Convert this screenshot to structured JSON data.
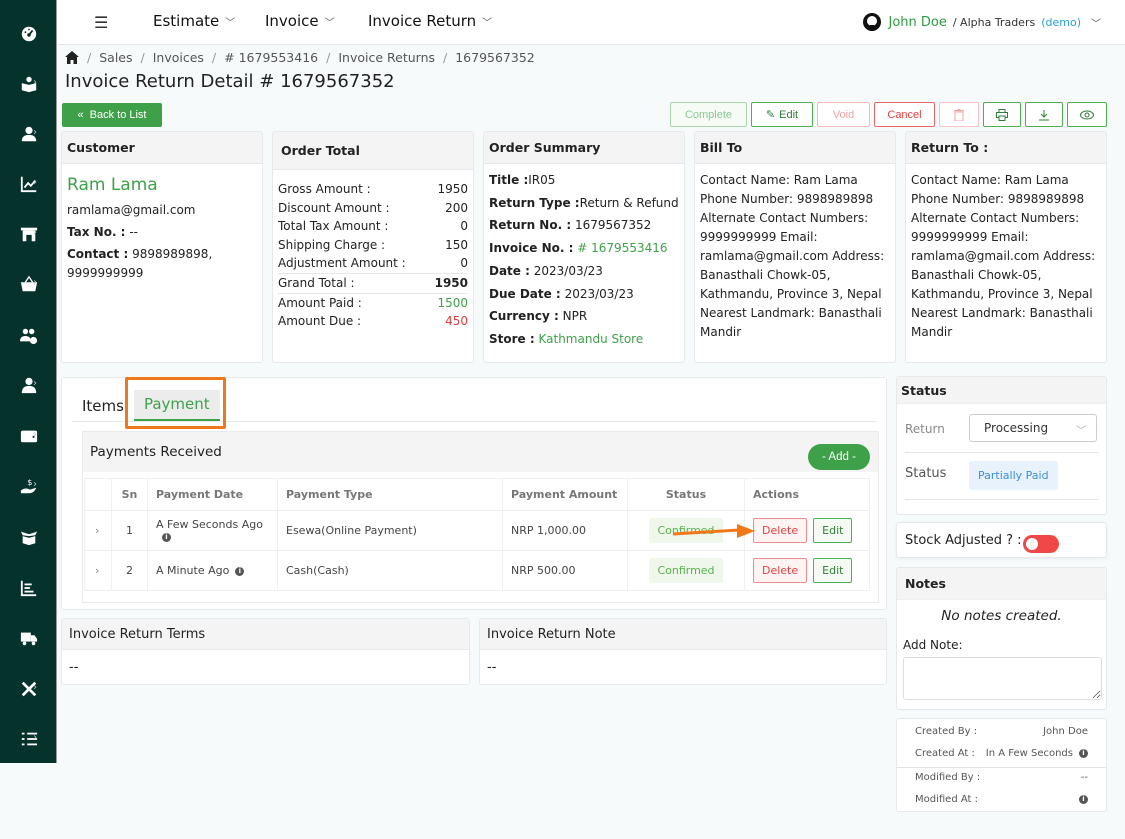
{
  "sidebar": {
    "items": [
      {
        "icon": "dashboard-icon",
        "has_sub": false
      },
      {
        "icon": "reader-icon",
        "has_sub": true
      },
      {
        "icon": "user-icon",
        "has_sub": true
      },
      {
        "icon": "chart-line-icon",
        "has_sub": true
      },
      {
        "icon": "store-icon",
        "has_sub": true
      },
      {
        "icon": "basket-icon",
        "has_sub": true
      },
      {
        "icon": "users-gear-icon",
        "has_sub": false
      },
      {
        "icon": "user-tie-icon",
        "has_sub": true
      },
      {
        "icon": "wallet-icon",
        "has_sub": true
      },
      {
        "icon": "hand-dollar-icon",
        "has_sub": true
      },
      {
        "icon": "box-open-icon",
        "has_sub": false
      },
      {
        "icon": "bar-chart-icon",
        "has_sub": false
      },
      {
        "icon": "truck-icon",
        "has_sub": false
      },
      {
        "icon": "tools-icon",
        "has_sub": true
      },
      {
        "icon": "tasks-list-icon",
        "has_sub": true
      }
    ]
  },
  "topbar": {
    "menu": [
      {
        "label": "Estimate"
      },
      {
        "label": "Invoice"
      },
      {
        "label": "Invoice Return"
      }
    ],
    "user": {
      "name": "John Doe",
      "org": "/ Alpha Traders",
      "tag": "(demo)"
    }
  },
  "breadcrumb": {
    "items": [
      "Sales",
      "Invoices",
      "# 1679553416",
      "Invoice Returns",
      "1679567352"
    ],
    "separator": "/"
  },
  "page_title": "Invoice Return Detail # 1679567352",
  "back_button": "Back to List",
  "toolbar": {
    "complete": "Complete",
    "edit": "Edit",
    "void": "Void",
    "cancel": "Cancel"
  },
  "customer": {
    "title": "Customer",
    "name": "Ram Lama",
    "email": "ramlama@gmail.com",
    "tax_label": "Tax No. :",
    "tax_value": "--",
    "contact_label": "Contact :",
    "contact_value": "9898989898, 9999999999"
  },
  "order_total": {
    "title": "Order Total",
    "rows": [
      {
        "label": "Gross Amount :",
        "value": "1950"
      },
      {
        "label": "Discount Amount :",
        "value": "200"
      },
      {
        "label": "Total Tax Amount :",
        "value": "0"
      },
      {
        "label": "Shipping Charge :",
        "value": "150"
      },
      {
        "label": "Adjustment Amount :",
        "value": "0"
      }
    ],
    "grand_label": "Grand Total :",
    "grand_value": "1950",
    "paid_label": "Amount Paid :",
    "paid_value": "1500",
    "due_label": "Amount Due :",
    "due_value": "450"
  },
  "order_summary": {
    "title": "Order Summary",
    "title_label": "Title :",
    "title_value": "IR05",
    "return_type_label": "Return Type :",
    "return_type_value": "Return & Refund",
    "return_no_label": "Return No. :",
    "return_no_value": "1679567352",
    "invoice_no_label": "Invoice No. :",
    "invoice_no_value": "# 1679553416",
    "date_label": "Date :",
    "date_value": "2023/03/23",
    "due_date_label": "Due Date :",
    "due_date_value": "2023/03/23",
    "currency_label": "Currency :",
    "currency_value": "NPR",
    "store_label": "Store :",
    "store_value": "Kathmandu Store"
  },
  "bill_to": {
    "title": "Bill To",
    "text": "Contact Name: Ram Lama Phone Number: 9898989898 Alternate Contact Numbers: 9999999999 Email: ramlama@gmail.com Address: Banasthali Chowk-05, Kathmandu, Province 3, Nepal Nearest Landmark: Banasthali Mandir"
  },
  "return_to": {
    "title": "Return To :",
    "text": "Contact Name: Ram Lama Phone Number: 9898989898 Alternate Contact Numbers: 9999999999 Email: ramlama@gmail.com Address: Banasthali Chowk-05, Kathmandu, Province 3, Nepal Nearest Landmark: Banasthali Mandir"
  },
  "tabs": [
    {
      "label": "Items",
      "active": false
    },
    {
      "label": "Payment",
      "active": true
    }
  ],
  "payments": {
    "title": "Payments Received",
    "add_label": "- Add -",
    "columns": [
      "",
      "Sn",
      "Payment Date",
      "Payment Type",
      "Payment Amount",
      "Status",
      "Actions"
    ],
    "rows": [
      {
        "sn": "1",
        "date": "A Few Seconds Ago",
        "type": "Esewa(Online Payment)",
        "amount": "NRP 1,000.00",
        "status": "Confirmed",
        "delete": "Delete",
        "edit": "Edit"
      },
      {
        "sn": "2",
        "date": "A Minute Ago",
        "type": "Cash(Cash)",
        "amount": "NRP 500.00",
        "status": "Confirmed",
        "delete": "Delete",
        "edit": "Edit"
      }
    ]
  },
  "terms": {
    "title": "Invoice Return Terms",
    "value": "--"
  },
  "note": {
    "title": "Invoice Return Note",
    "value": "--"
  },
  "status_panel": {
    "title": "Status",
    "return_label": "Return",
    "return_value": "Processing",
    "status_label": "Status",
    "status_value": "Partially Paid"
  },
  "stock": {
    "label": "Stock Adjusted ? :",
    "value": false
  },
  "notes": {
    "title": "Notes",
    "empty": "No notes created.",
    "add_label": "Add Note:",
    "input_value": ""
  },
  "meta": {
    "created_by_label": "Created By :",
    "created_by_value": "John Doe",
    "created_at_label": "Created At :",
    "created_at_value": "In A Few Seconds",
    "modified_by_label": "Modified By :",
    "modified_by_value": "--",
    "modified_at_label": "Modified At :",
    "modified_at_value": ""
  },
  "colors": {
    "sidebar": "#05332b",
    "primary_green": "#3fa04a",
    "danger": "#e03a3a",
    "highlight": "#f07818"
  }
}
